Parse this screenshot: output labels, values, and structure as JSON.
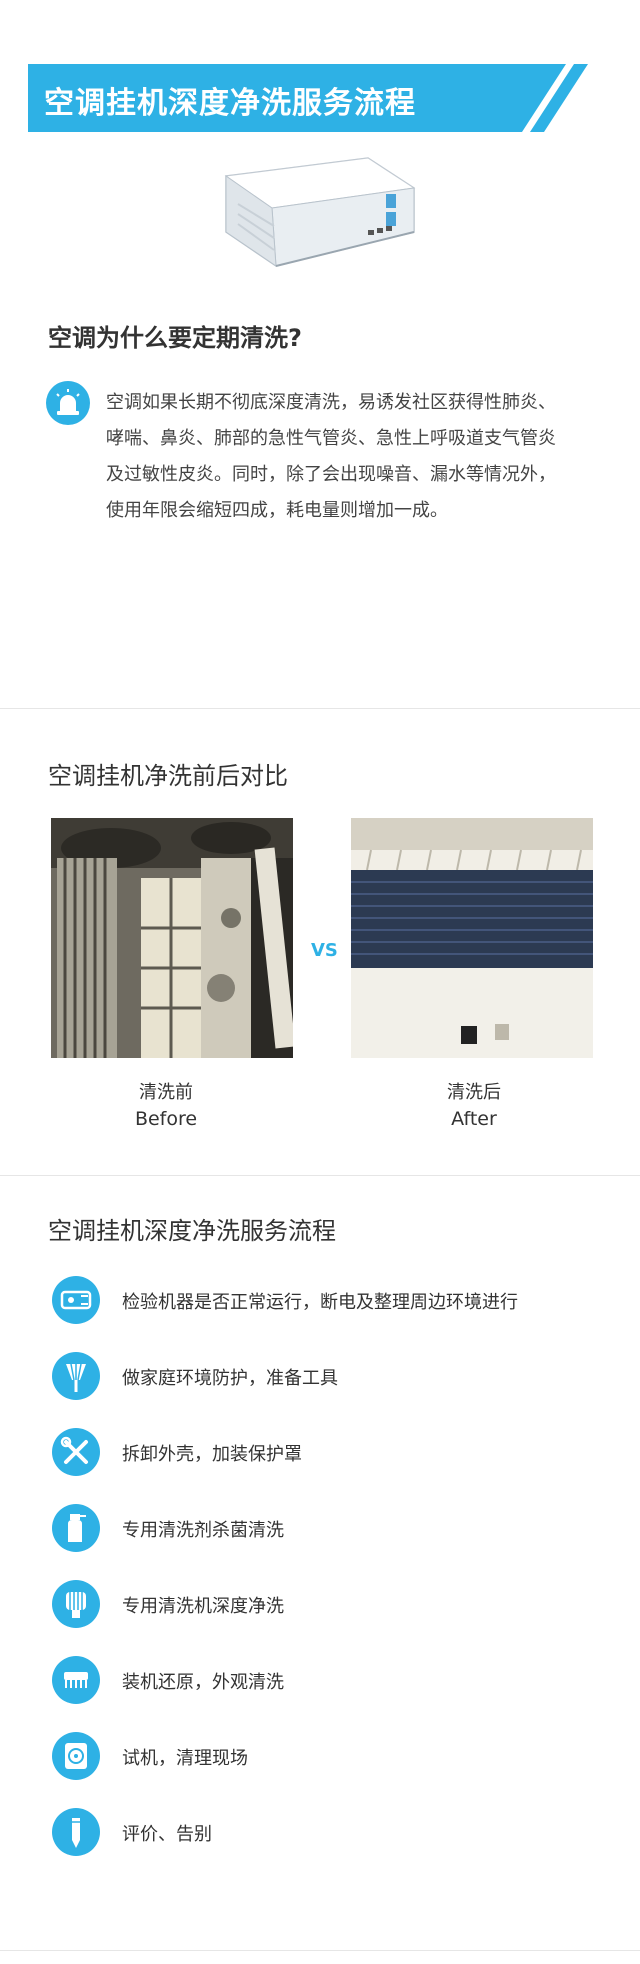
{
  "header": {
    "title": "空调挂机深度净洗服务流程"
  },
  "why": {
    "heading": "空调为什么要定期清洗?",
    "body": "空调如果长期不彻底深度清洗，易诱发社区获得性肺炎、哮喘、鼻炎、肺部的急性气管炎、急性上呼吸道支气管炎及过敏性皮炎。同时，除了会出现噪音、漏水等情况外，使用年限会缩短四成，耗电量则增加一成。"
  },
  "compare": {
    "heading": "空调挂机净洗前后对比",
    "vs": "VS",
    "before": {
      "cn": "清洗前",
      "en": "Before"
    },
    "after": {
      "cn": "清洗后",
      "en": "After"
    }
  },
  "process": {
    "heading": "空调挂机深度净洗服务流程",
    "steps": [
      {
        "icon": "plug-icon",
        "text": "检验机器是否正常运行，断电及整理周边环境进行"
      },
      {
        "icon": "duster-icon",
        "text": "做家庭环境防护，准备工具"
      },
      {
        "icon": "tools-icon",
        "text": "拆卸外壳，加装保护罩"
      },
      {
        "icon": "spray-bottle-icon",
        "text": "专用清洗剂杀菌清洗"
      },
      {
        "icon": "cleaning-machine-icon",
        "text": "专用清洗机深度净洗"
      },
      {
        "icon": "brush-icon",
        "text": "装机还原，外观清洗"
      },
      {
        "icon": "test-run-icon",
        "text": "试机，清理现场"
      },
      {
        "icon": "pen-icon",
        "text": "评价、告别"
      }
    ]
  },
  "colors": {
    "accent": "#2eb1e5",
    "text": "#333333"
  }
}
